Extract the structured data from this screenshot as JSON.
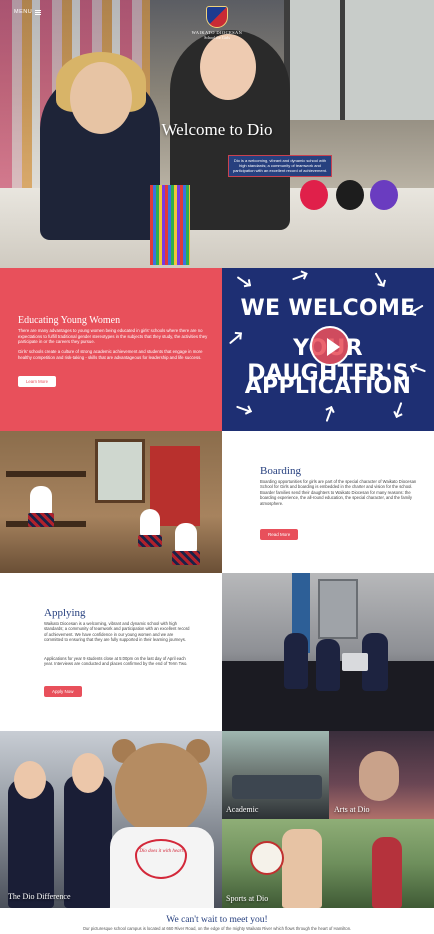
{
  "header": {
    "menu_label": "MENU",
    "logo_line1": "WAIKATO DIOCESAN",
    "logo_line2": "School for Girls"
  },
  "hero": {
    "title": "Welcome to Dio",
    "intro": "Dio is a welcoming, vibrant and dynamic school with high standards; a community of teamwork and participation with an excellent record of achievement."
  },
  "educating": {
    "title": "Educating Young Women",
    "para1": "There are many advantages to young women being educated in girls' schools where there are no expectations to fulfill traditional gender stereotypes in the subjects that they study, the activities they participate in or the careers they pursue.",
    "para2": "Girls' schools create a culture of strong academic achievement and students that engage in more healthy competition and risk-taking - skills that are advantageous for leadership and life success.",
    "button": "Learn More"
  },
  "video": {
    "line1": "WE WELCOME",
    "line2": "YOUR DAUGHTER'S",
    "line3": "APPLICATION"
  },
  "boarding": {
    "title": "Boarding",
    "text": "Boarding opportunities for girls are part of the special character of Waikato Diocesan School for Girls and boarding is embedded in the charter and vision for the school. Boarder families send their daughters to Waikato Diocesan for many reasons: the boarding experience, the all-round education, the special character, and the family atmosphere.",
    "button": "Read More"
  },
  "applying": {
    "title": "Applying",
    "para1": "Waikato Diocesan is a welcoming, vibrant and dynamic school with high standards; a community of teamwork and participation with an excellent record of achievement. We have confidence in our young women and we are committed to ensuring that they are fully supported in their learning journeys.",
    "para2": "Applications for year 9 students close at 5:00pm on the last day of April each year. Interviews are conducted and places confirmed by the end of Term Two.",
    "button": "Apply Now"
  },
  "tiles": {
    "difference": "The Dio Difference",
    "academic": "Academic",
    "arts": "Arts at Dio",
    "sports": "Sports at Dio",
    "bear_shirt": "Dio does it with heart!"
  },
  "footer": {
    "title": "We can't wait to meet you!",
    "text": "Our picturesque school campus is located at 660 River Road, on the edge of the mighty Waikato River which flows through the heart of Hamilton."
  },
  "colors": {
    "accent_red": "#e8505b",
    "navy": "#27407f"
  }
}
